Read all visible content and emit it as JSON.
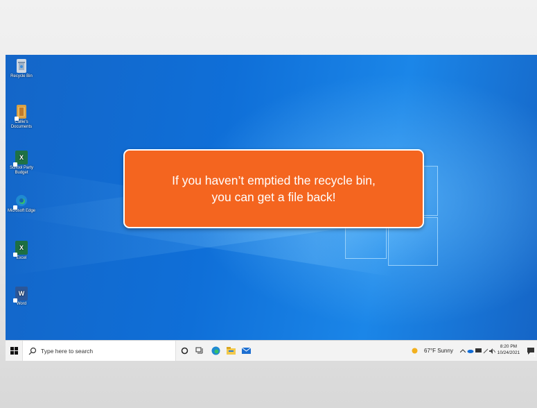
{
  "desktop": {
    "icons": [
      {
        "label": "Recycle Bin",
        "icon": "recycle-bin-icon",
        "color": "#cfd8e3"
      },
      {
        "label": "Callie's Documents",
        "icon": "folder-icon",
        "color": "#d8a045"
      },
      {
        "label": "School Party Budget",
        "icon": "excel-file-icon",
        "color": "#1e7145"
      },
      {
        "label": "Microsoft Edge",
        "icon": "edge-icon",
        "color": "#1f8ad2"
      },
      {
        "label": "Excel",
        "icon": "excel-icon",
        "color": "#1d6f42"
      },
      {
        "label": "Word",
        "icon": "word-icon",
        "color": "#2b579a"
      }
    ]
  },
  "callout": {
    "line1": "If you haven’t emptied the recycle bin,",
    "line2": "you can get a file back!",
    "color": "#f4651f"
  },
  "taskbar": {
    "search_placeholder": "Type here to search",
    "weather": "67°F  Sunny",
    "time": "8:20 PM",
    "date": "10/24/2021",
    "notification_count": "1"
  }
}
